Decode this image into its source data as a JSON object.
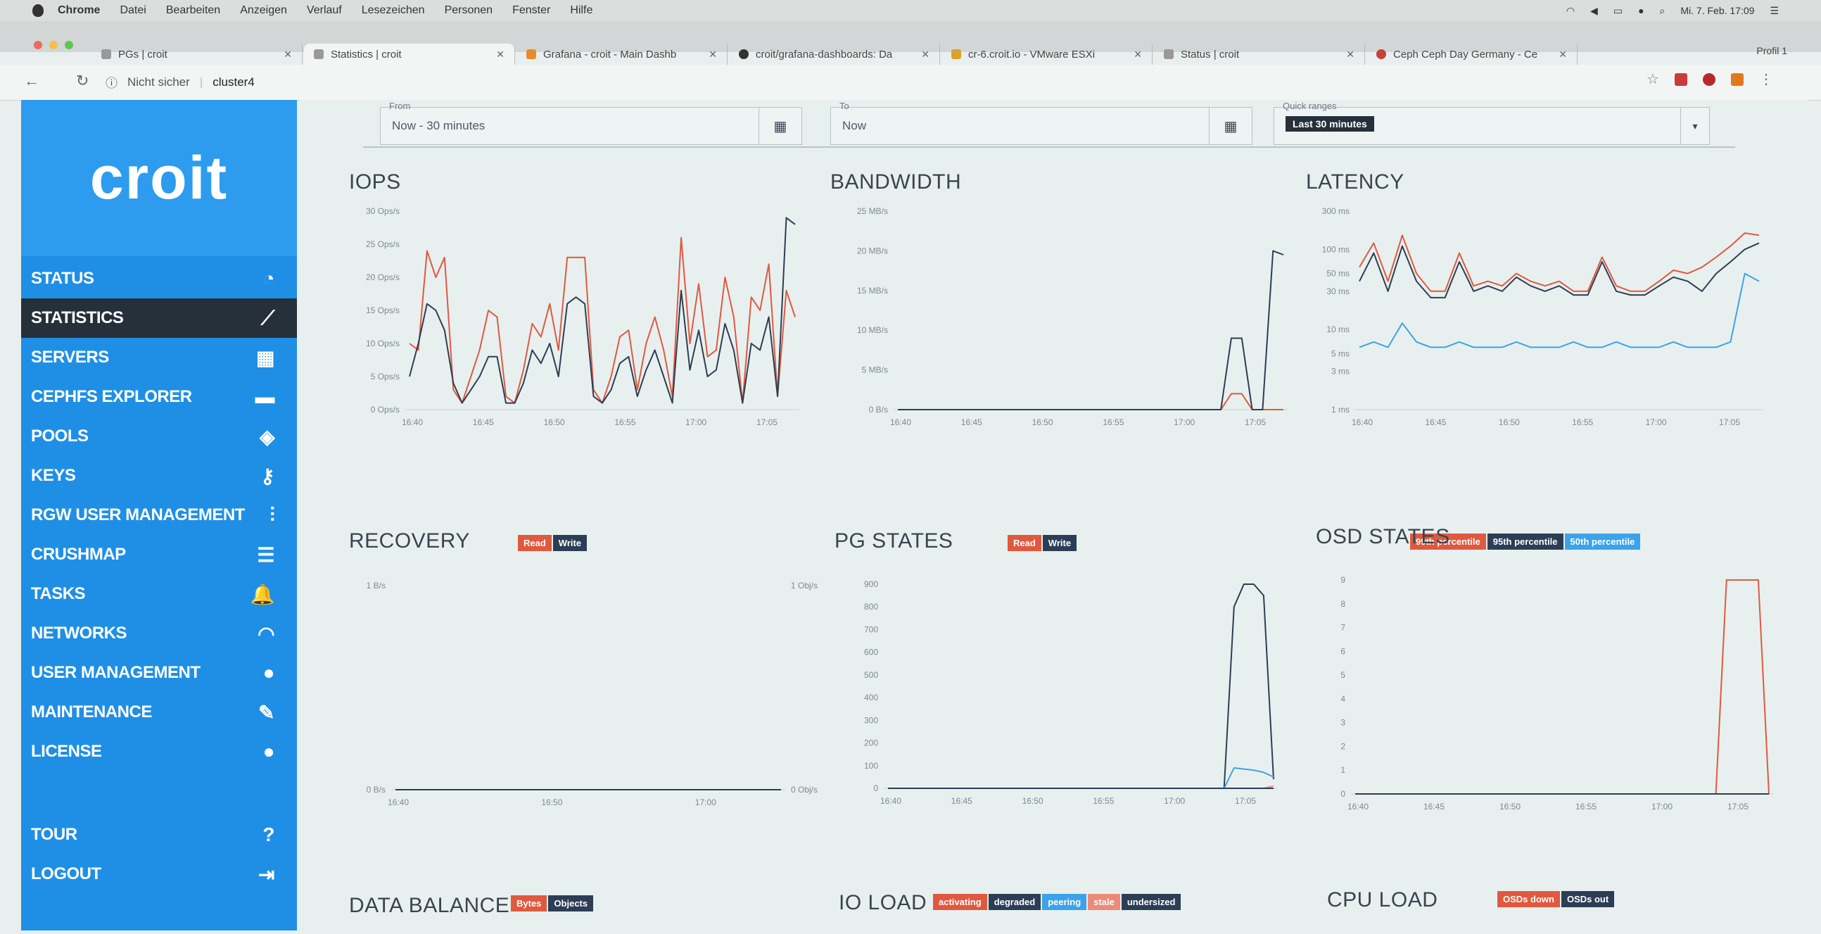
{
  "menubar": {
    "app": "Chrome",
    "items": [
      "Datei",
      "Bearbeiten",
      "Anzeigen",
      "Verlauf",
      "Lesezeichen",
      "Personen",
      "Fenster",
      "Hilfe"
    ],
    "clock": "Mi. 7. Feb. 17:09"
  },
  "tabs": [
    {
      "label": "PGs | croit",
      "active": false
    },
    {
      "label": "Statistics | croit",
      "active": true
    },
    {
      "label": "Grafana - croit - Main Dashb",
      "active": false
    },
    {
      "label": "croit/grafana-dashboards: Da",
      "active": false
    },
    {
      "label": "cr-6.croit.io - VMware ESXi",
      "active": false
    },
    {
      "label": "Status | croit",
      "active": false
    },
    {
      "label": "Ceph Ceph Day Germany - Ce",
      "active": false
    }
  ],
  "profile": "Profil 1",
  "address": {
    "security": "Nicht sicher",
    "host": "cluster4"
  },
  "sidebar": {
    "logo": "croit",
    "items": [
      {
        "label": "STATUS",
        "icon": "pie-chart-icon",
        "glyph": "◔"
      },
      {
        "label": "STATISTICS",
        "icon": "trend-line-icon",
        "glyph": "⟋",
        "active": true
      },
      {
        "label": "SERVERS",
        "icon": "server-icon",
        "glyph": "▦"
      },
      {
        "label": "CEPHFS EXPLORER",
        "icon": "folder-icon",
        "glyph": "▬"
      },
      {
        "label": "POOLS",
        "icon": "droplet-icon",
        "glyph": "◈"
      },
      {
        "label": "KEYS",
        "icon": "key-icon",
        "glyph": "⚷"
      },
      {
        "label": "RGW USER MANAGEMENT",
        "icon": "sliders-icon",
        "glyph": "⫶"
      },
      {
        "label": "CRUSHMAP",
        "icon": "list-icon",
        "glyph": "☰"
      },
      {
        "label": "TASKS",
        "icon": "bell-icon",
        "glyph": "🔔"
      },
      {
        "label": "NETWORKS",
        "icon": "wifi-icon",
        "glyph": "◠"
      },
      {
        "label": "USER MANAGEMENT",
        "icon": "user-icon",
        "glyph": "●"
      },
      {
        "label": "MAINTENANCE",
        "icon": "wrench-icon",
        "glyph": "✎"
      },
      {
        "label": "LICENSE",
        "icon": "globe-icon",
        "glyph": "●"
      }
    ],
    "bottom": [
      {
        "label": "TOUR",
        "icon": "question-icon",
        "glyph": "?"
      },
      {
        "label": "LOGOUT",
        "icon": "logout-icon",
        "glyph": "⇥"
      }
    ],
    "close": "✕"
  },
  "timepicker": {
    "from_label": "From",
    "from_value": "Now - 30 minutes",
    "to_label": "To",
    "to_value": "Now",
    "quick_label": "Quick ranges",
    "quick_value": "Last 30 minutes"
  },
  "colors": {
    "red": "#e0593f",
    "navy": "#2c3e55",
    "blue": "#3aa3ea",
    "salmon": "#eb8a77"
  },
  "panels": {
    "iops": {
      "title": "IOPS",
      "legend": [
        "Read",
        "Write"
      ]
    },
    "bandwidth": {
      "title": "BANDWIDTH",
      "legend": [
        "Read",
        "Write"
      ]
    },
    "latency": {
      "title": "LATENCY",
      "legend": [
        "99th percentile",
        "95th percentile",
        "50th percentile"
      ]
    },
    "recovery": {
      "title": "RECOVERY",
      "legend": [
        "Bytes",
        "Objects"
      ]
    },
    "pgstates": {
      "title": "PG STATES",
      "legend": [
        "activating",
        "degraded",
        "peering",
        "stale",
        "undersized"
      ]
    },
    "osdstates": {
      "title": "OSD STATES",
      "legend": [
        "OSDs down",
        "OSDs out"
      ]
    },
    "databalance": {
      "title": "DATA BALANCE"
    },
    "ioload": {
      "title": "IO LOAD"
    },
    "cpuload": {
      "title": "CPU LOAD"
    }
  },
  "chart_data": [
    {
      "type": "line",
      "title": "IOPS",
      "x": [
        "16:40",
        "16:45",
        "16:50",
        "16:55",
        "17:00",
        "17:05"
      ],
      "y_ticks": [
        "0 Ops/s",
        "5 Ops/s",
        "10 Ops/s",
        "15 Ops/s",
        "20 Ops/s",
        "25 Ops/s",
        "30 Ops/s"
      ],
      "ylim": [
        0,
        30
      ],
      "series": [
        {
          "name": "Read",
          "color": "#e0593f",
          "values": [
            10,
            9,
            24,
            20,
            23,
            3,
            1,
            5,
            9,
            15,
            14,
            2,
            1,
            6,
            13,
            11,
            16,
            9,
            23,
            23,
            23,
            3,
            1,
            5,
            11,
            12,
            3,
            10,
            14,
            9,
            2,
            26,
            10,
            19,
            8,
            9,
            20,
            14,
            1,
            17,
            15,
            22,
            2,
            18,
            14
          ]
        },
        {
          "name": "Write",
          "color": "#2c3e55",
          "values": [
            5,
            10,
            16,
            15,
            12,
            4,
            1,
            3,
            5,
            8,
            8,
            1,
            1,
            4,
            9,
            7,
            10,
            5,
            16,
            17,
            16,
            2,
            1,
            3,
            7,
            8,
            2,
            6,
            9,
            5,
            1,
            18,
            6,
            12,
            5,
            6,
            13,
            9,
            1,
            10,
            9,
            14,
            2,
            29,
            28
          ]
        }
      ]
    },
    {
      "type": "line",
      "title": "BANDWIDTH",
      "x": [
        "16:40",
        "16:45",
        "16:50",
        "16:55",
        "17:00",
        "17:05"
      ],
      "y_ticks": [
        "0 B/s",
        "5 MB/s",
        "10 MB/s",
        "15 MB/s",
        "20 MB/s",
        "25 MB/s"
      ],
      "ylim": [
        0,
        25
      ],
      "series": [
        {
          "name": "Read",
          "color": "#e0593f",
          "values": [
            0,
            0,
            0,
            0,
            0,
            0,
            0,
            0,
            0,
            0,
            0,
            0,
            0,
            0,
            0,
            0,
            0,
            0,
            0,
            0,
            0,
            0,
            0,
            0,
            0,
            0,
            0,
            0,
            0,
            0,
            0,
            0,
            2,
            2,
            0,
            0,
            0,
            0
          ]
        },
        {
          "name": "Write",
          "color": "#2c3e55",
          "values": [
            0,
            0,
            0,
            0,
            0,
            0,
            0,
            0,
            0,
            0,
            0,
            0,
            0,
            0,
            0,
            0,
            0,
            0,
            0,
            0,
            0,
            0,
            0,
            0,
            0,
            0,
            0,
            0,
            0,
            0,
            0,
            0,
            9,
            9,
            0,
            0,
            20,
            19.5
          ]
        }
      ]
    },
    {
      "type": "line",
      "title": "LATENCY",
      "yscale": "log",
      "x": [
        "16:40",
        "16:45",
        "16:50",
        "16:55",
        "17:00",
        "17:05"
      ],
      "y_ticks": [
        "1 ms",
        "3 ms",
        "5 ms",
        "10 ms",
        "30 ms",
        "50 ms",
        "100 ms",
        "300 ms"
      ],
      "ylim": [
        1,
        300
      ],
      "series": [
        {
          "name": "99th percentile",
          "color": "#e0593f",
          "values": [
            60,
            120,
            40,
            150,
            50,
            30,
            30,
            90,
            35,
            40,
            35,
            50,
            40,
            35,
            40,
            30,
            30,
            80,
            35,
            30,
            30,
            40,
            55,
            50,
            60,
            80,
            110,
            160,
            150
          ]
        },
        {
          "name": "95th percentile",
          "color": "#2c3e55",
          "values": [
            40,
            90,
            30,
            110,
            40,
            25,
            25,
            70,
            30,
            35,
            30,
            45,
            35,
            30,
            35,
            27,
            27,
            70,
            30,
            27,
            27,
            35,
            45,
            40,
            30,
            50,
            70,
            100,
            120
          ]
        },
        {
          "name": "50th percentile",
          "color": "#3aa3ea",
          "values": [
            6,
            7,
            6,
            12,
            7,
            6,
            6,
            7,
            6,
            6,
            6,
            7,
            6,
            6,
            6,
            7,
            6,
            6,
            7,
            6,
            6,
            6,
            7,
            6,
            6,
            6,
            7,
            50,
            40
          ]
        }
      ]
    },
    {
      "type": "line",
      "title": "RECOVERY",
      "x": [
        "16:40",
        "16:50",
        "17:00"
      ],
      "y_ticks_left": [
        "0 B/s",
        "1 B/s"
      ],
      "y_ticks_right": [
        "0 Obj/s",
        "1 Obj/s"
      ],
      "series": [
        {
          "name": "Bytes",
          "color": "#e0593f",
          "values": [
            0,
            0,
            0,
            0,
            0,
            0,
            0,
            0
          ]
        },
        {
          "name": "Objects",
          "color": "#2c3e55",
          "values": [
            0,
            0,
            0,
            0,
            0,
            0,
            0,
            0
          ]
        }
      ]
    },
    {
      "type": "line",
      "title": "PG STATES",
      "x": [
        "16:40",
        "16:45",
        "16:50",
        "16:55",
        "17:00",
        "17:05"
      ],
      "y_ticks": [
        "0",
        "100",
        "200",
        "300",
        "400",
        "500",
        "600",
        "700",
        "800",
        "900"
      ],
      "ylim": [
        0,
        900
      ],
      "series": [
        {
          "name": "activating",
          "color": "#e0593f",
          "values": [
            0,
            0,
            0,
            0,
            0,
            0,
            0,
            0,
            0,
            0,
            0,
            0,
            0,
            0,
            0,
            0,
            0,
            0,
            0,
            0,
            0,
            0,
            0,
            0,
            0,
            0,
            0,
            0,
            0,
            0,
            0,
            0,
            0,
            0,
            0,
            0,
            0,
            0,
            0,
            0
          ]
        },
        {
          "name": "degraded",
          "color": "#2c3e55",
          "values": [
            0,
            0,
            0,
            0,
            0,
            0,
            0,
            0,
            0,
            0,
            0,
            0,
            0,
            0,
            0,
            0,
            0,
            0,
            0,
            0,
            0,
            0,
            0,
            0,
            0,
            0,
            0,
            0,
            0,
            0,
            0,
            0,
            0,
            0,
            0,
            800,
            900,
            900,
            850,
            40
          ]
        },
        {
          "name": "peering",
          "color": "#3aa3ea",
          "values": [
            0,
            0,
            0,
            0,
            0,
            0,
            0,
            0,
            0,
            0,
            0,
            0,
            0,
            0,
            0,
            0,
            0,
            0,
            0,
            0,
            0,
            0,
            0,
            0,
            0,
            0,
            0,
            0,
            0,
            0,
            0,
            0,
            0,
            0,
            0,
            90,
            85,
            80,
            70,
            50
          ]
        },
        {
          "name": "stale",
          "color": "#eb8a77",
          "values": [
            0,
            0,
            0,
            0,
            0,
            0,
            0,
            0,
            0,
            0,
            0,
            0,
            0,
            0,
            0,
            0,
            0,
            0,
            0,
            0,
            0,
            0,
            0,
            0,
            0,
            0,
            0,
            0,
            0,
            0,
            0,
            0,
            0,
            0,
            0,
            0,
            0,
            0,
            0,
            10
          ]
        },
        {
          "name": "undersized",
          "color": "#2c3e55",
          "values": [
            0,
            0,
            0,
            0,
            0,
            0,
            0,
            0,
            0,
            0,
            0,
            0,
            0,
            0,
            0,
            0,
            0,
            0,
            0,
            0,
            0,
            0,
            0,
            0,
            0,
            0,
            0,
            0,
            0,
            0,
            0,
            0,
            0,
            0,
            0,
            0,
            0,
            0,
            0,
            0
          ]
        }
      ]
    },
    {
      "type": "line",
      "title": "OSD STATES",
      "x": [
        "16:40",
        "16:45",
        "16:50",
        "16:55",
        "17:00",
        "17:05"
      ],
      "y_ticks": [
        "0",
        "1",
        "2",
        "3",
        "4",
        "5",
        "6",
        "7",
        "8",
        "9"
      ],
      "ylim": [
        0,
        9
      ],
      "series": [
        {
          "name": "OSDs down",
          "color": "#e0593f",
          "values": [
            0,
            0,
            0,
            0,
            0,
            0,
            0,
            0,
            0,
            0,
            0,
            0,
            0,
            0,
            0,
            0,
            0,
            0,
            0,
            0,
            0,
            0,
            0,
            0,
            0,
            0,
            0,
            0,
            0,
            0,
            0,
            0,
            0,
            0,
            0,
            9,
            9,
            9,
            9,
            0
          ]
        },
        {
          "name": "OSDs out",
          "color": "#2c3e55",
          "values": [
            0,
            0,
            0,
            0,
            0,
            0,
            0,
            0,
            0,
            0,
            0,
            0,
            0,
            0,
            0,
            0,
            0,
            0,
            0,
            0,
            0,
            0,
            0,
            0,
            0,
            0,
            0,
            0,
            0,
            0,
            0,
            0,
            0,
            0,
            0,
            0,
            0,
            0,
            0,
            0
          ]
        }
      ]
    }
  ]
}
